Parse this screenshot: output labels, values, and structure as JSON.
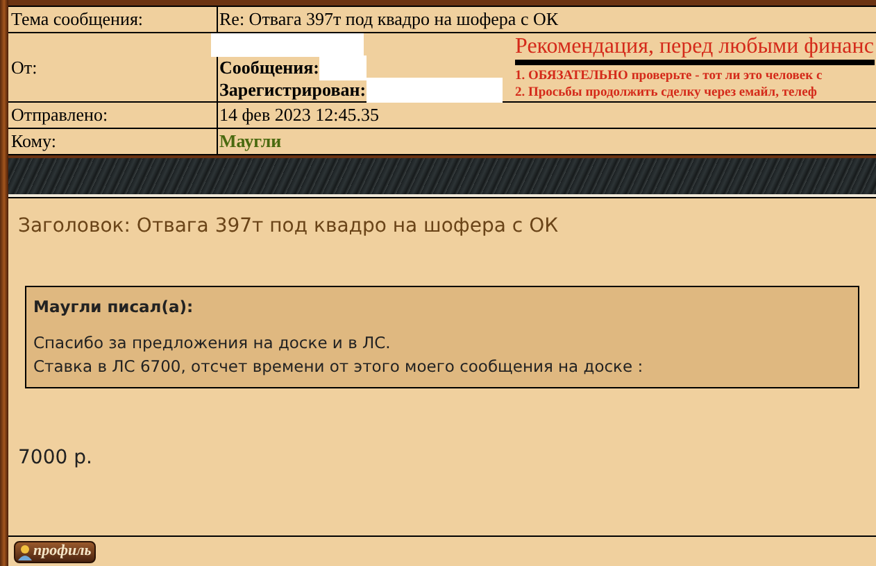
{
  "header": {
    "rows": [
      {
        "label": "Тема сообщения:",
        "value": "Re: Отвага 397т под квадро на шофера с ОК",
        "kind": "text"
      },
      {
        "label": "От:",
        "kind": "author",
        "fields": [
          {
            "label": "Сообщения:"
          },
          {
            "label": "Зарегистрирован:"
          }
        ]
      },
      {
        "label": "Отправлено:",
        "value": "14 фев 2023 12:45.35",
        "kind": "text"
      },
      {
        "label": "Кому:",
        "value": "Маугли",
        "kind": "link"
      }
    ]
  },
  "notice": {
    "title": "Рекомендация, перед любыми финанс",
    "lines": [
      "1. ОБЯЗАТЕЛЬНО проверьте - тот ли это человек с",
      "2. Просьбы продолжить сделку через емайл, телеф"
    ]
  },
  "post": {
    "subject": "Заголовок: Отвага 397т под квадро на шофера с ОК",
    "quote": {
      "author": "Маугли писал(а):",
      "lines": [
        "Спасибо за предложения на доске и в ЛС.",
        "Ставка в ЛС 6700, отсчет времени от этого моего сообщения на доске :"
      ]
    },
    "body": "7000 р."
  },
  "footer": {
    "button": "профиль"
  }
}
